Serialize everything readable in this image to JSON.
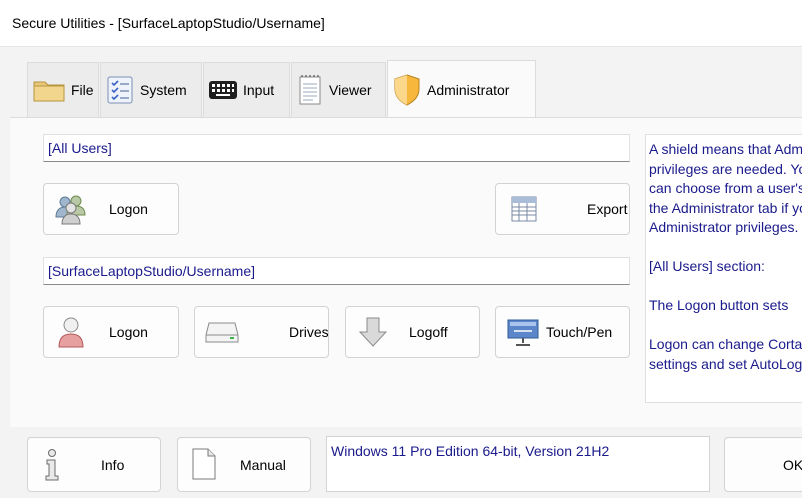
{
  "window": {
    "title": "Secure Utilities - [SurfaceLaptopStudio/Username]"
  },
  "tabs": [
    {
      "label": "File",
      "icon": "folder-icon"
    },
    {
      "label": "System",
      "icon": "checklist-icon"
    },
    {
      "label": "Input",
      "icon": "keyboard-icon"
    },
    {
      "label": "Viewer",
      "icon": "notepad-icon"
    },
    {
      "label": "Administrator",
      "icon": "shield-icon",
      "active": true
    }
  ],
  "all_users": {
    "header": "[All Users]",
    "logon_label": "Logon",
    "export_label": "Export"
  },
  "user": {
    "header": "[SurfaceLaptopStudio/Username]",
    "logon_label": "Logon",
    "drives_label": "Drives",
    "logoff_label": "Logoff",
    "touchpen_label": "Touch/Pen"
  },
  "help": {
    "lines": [
      "A shield means that Administrator",
      "privileges are needed. You",
      "can choose from a user's",
      "the Administrator tab if you have",
      "Administrator privileges.",
      "",
      "[All Users] section:",
      "",
      "The Logon button sets",
      "",
      "Logon can change Cortana",
      "settings and set AutoLogon"
    ]
  },
  "footer": {
    "info_label": "Info",
    "manual_label": "Manual",
    "status_text": "Windows 11 Pro Edition 64-bit, Version 21H2",
    "ok_label": "OK"
  },
  "colors": {
    "link_text": "#1a1a8c",
    "panel_bg": "#fafafa",
    "window_bg": "#f3f3f3"
  }
}
